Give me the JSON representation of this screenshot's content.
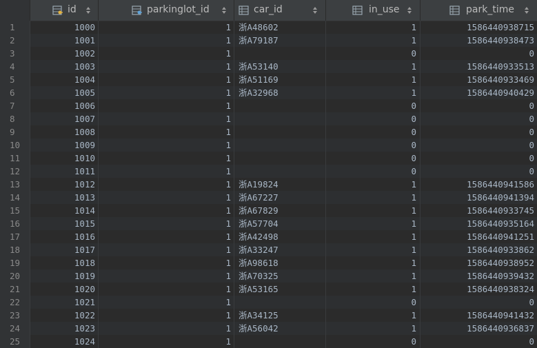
{
  "columns": [
    {
      "key": "id",
      "label": "id",
      "icon": "primary-key-column-icon"
    },
    {
      "key": "parkinglot_id",
      "label": "parkinglot_id",
      "icon": "foreign-key-column-icon"
    },
    {
      "key": "car_id",
      "label": "car_id",
      "icon": "column-icon"
    },
    {
      "key": "in_use",
      "label": "in_use",
      "icon": "column-icon"
    },
    {
      "key": "park_time",
      "label": "park_time",
      "icon": "column-icon"
    }
  ],
  "rows": [
    {
      "n": "1",
      "id": "1000",
      "parkinglot_id": "1",
      "car_id": "浙A48602",
      "in_use": "1",
      "park_time": "1586440938715"
    },
    {
      "n": "2",
      "id": "1001",
      "parkinglot_id": "1",
      "car_id": "浙A79187",
      "in_use": "1",
      "park_time": "1586440938473"
    },
    {
      "n": "3",
      "id": "1002",
      "parkinglot_id": "1",
      "car_id": "",
      "in_use": "0",
      "park_time": "0"
    },
    {
      "n": "4",
      "id": "1003",
      "parkinglot_id": "1",
      "car_id": "浙A53140",
      "in_use": "1",
      "park_time": "1586440933513"
    },
    {
      "n": "5",
      "id": "1004",
      "parkinglot_id": "1",
      "car_id": "浙A51169",
      "in_use": "1",
      "park_time": "1586440933469"
    },
    {
      "n": "6",
      "id": "1005",
      "parkinglot_id": "1",
      "car_id": "浙A32968",
      "in_use": "1",
      "park_time": "1586440940429"
    },
    {
      "n": "7",
      "id": "1006",
      "parkinglot_id": "1",
      "car_id": "",
      "in_use": "0",
      "park_time": "0"
    },
    {
      "n": "8",
      "id": "1007",
      "parkinglot_id": "1",
      "car_id": "",
      "in_use": "0",
      "park_time": "0"
    },
    {
      "n": "9",
      "id": "1008",
      "parkinglot_id": "1",
      "car_id": "",
      "in_use": "0",
      "park_time": "0"
    },
    {
      "n": "10",
      "id": "1009",
      "parkinglot_id": "1",
      "car_id": "",
      "in_use": "0",
      "park_time": "0"
    },
    {
      "n": "11",
      "id": "1010",
      "parkinglot_id": "1",
      "car_id": "",
      "in_use": "0",
      "park_time": "0"
    },
    {
      "n": "12",
      "id": "1011",
      "parkinglot_id": "1",
      "car_id": "",
      "in_use": "0",
      "park_time": "0"
    },
    {
      "n": "13",
      "id": "1012",
      "parkinglot_id": "1",
      "car_id": "浙A19824",
      "in_use": "1",
      "park_time": "1586440941586"
    },
    {
      "n": "14",
      "id": "1013",
      "parkinglot_id": "1",
      "car_id": "浙A67227",
      "in_use": "1",
      "park_time": "1586440941394"
    },
    {
      "n": "15",
      "id": "1014",
      "parkinglot_id": "1",
      "car_id": "浙A67829",
      "in_use": "1",
      "park_time": "1586440933745"
    },
    {
      "n": "16",
      "id": "1015",
      "parkinglot_id": "1",
      "car_id": "浙A57704",
      "in_use": "1",
      "park_time": "1586440935164"
    },
    {
      "n": "17",
      "id": "1016",
      "parkinglot_id": "1",
      "car_id": "浙A42498",
      "in_use": "1",
      "park_time": "1586440941251"
    },
    {
      "n": "18",
      "id": "1017",
      "parkinglot_id": "1",
      "car_id": "浙A33247",
      "in_use": "1",
      "park_time": "1586440933862"
    },
    {
      "n": "19",
      "id": "1018",
      "parkinglot_id": "1",
      "car_id": "浙A98618",
      "in_use": "1",
      "park_time": "1586440938952"
    },
    {
      "n": "20",
      "id": "1019",
      "parkinglot_id": "1",
      "car_id": "浙A70325",
      "in_use": "1",
      "park_time": "1586440939432"
    },
    {
      "n": "21",
      "id": "1020",
      "parkinglot_id": "1",
      "car_id": "浙A53165",
      "in_use": "1",
      "park_time": "1586440938324"
    },
    {
      "n": "22",
      "id": "1021",
      "parkinglot_id": "1",
      "car_id": "",
      "in_use": "0",
      "park_time": "0"
    },
    {
      "n": "23",
      "id": "1022",
      "parkinglot_id": "1",
      "car_id": "浙A34125",
      "in_use": "1",
      "park_time": "1586440941432"
    },
    {
      "n": "24",
      "id": "1023",
      "parkinglot_id": "1",
      "car_id": "浙A56042",
      "in_use": "1",
      "park_time": "1586440936837"
    },
    {
      "n": "25",
      "id": "1024",
      "parkinglot_id": "1",
      "car_id": "",
      "in_use": "0",
      "park_time": "0"
    }
  ]
}
